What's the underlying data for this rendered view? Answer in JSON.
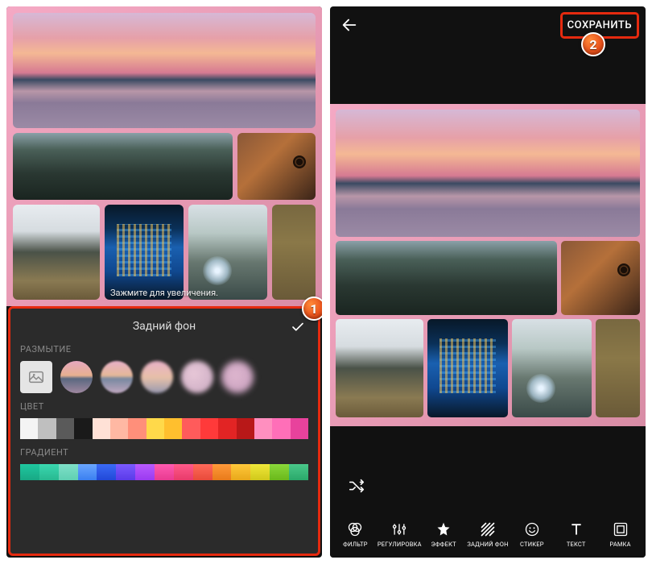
{
  "left": {
    "hint": "Зажмите для увеличения.",
    "panel_title": "Задний фон",
    "section_blur": "РАЗМЫТИЕ",
    "section_color": "ЦВЕТ",
    "section_gradient": "ГРАДИЕНТ",
    "marker": "1",
    "colors": [
      "#f4f4f4",
      "#bfbfbf",
      "#5a5a5a",
      "#1a1a1a",
      "#ffe1d6",
      "#ffb8a3",
      "#ff8f7a",
      "#ffd94a",
      "#ffbf2e",
      "#ff5b5b",
      "#ff3a3a",
      "#e22424",
      "#b81818",
      "#ff8fbf",
      "#ff6fb8",
      "#e8429c"
    ],
    "gradients": [
      [
        "#1fc8a0",
        "#18a884"
      ],
      [
        "#3ad8b0",
        "#28b890"
      ],
      [
        "#7fe0c8",
        "#5fcfb2"
      ],
      [
        "#6aa6ff",
        "#3a7ff0"
      ],
      [
        "#3a6af5",
        "#2148d8"
      ],
      [
        "#7a5aff",
        "#5a3ae8"
      ],
      [
        "#b85aff",
        "#9a3af0"
      ],
      [
        "#ff5ab0",
        "#e83a90"
      ],
      [
        "#ff5a8a",
        "#e83a6a"
      ],
      [
        "#ff6a5a",
        "#e84a3a"
      ],
      [
        "#ff9a3a",
        "#e87a1a"
      ],
      [
        "#ffc83a",
        "#e8a81a"
      ],
      [
        "#f0e83a",
        "#d0c81a"
      ],
      [
        "#8ad83a",
        "#6ab81a"
      ],
      [
        "#4ac88a",
        "#2aa86a"
      ]
    ]
  },
  "right": {
    "save_label": "СОХРАНИТЬ",
    "marker": "2",
    "tools": [
      {
        "id": "filter",
        "label": "ФИЛЬТР"
      },
      {
        "id": "adjust",
        "label": "РЕГУЛИРОВКА"
      },
      {
        "id": "effect",
        "label": "ЭФФЕКТ"
      },
      {
        "id": "background",
        "label": "ЗАДНИЙ ФОН"
      },
      {
        "id": "sticker",
        "label": "СТИКЕР"
      },
      {
        "id": "text",
        "label": "ТЕКСТ"
      },
      {
        "id": "frame",
        "label": "РАМКА"
      }
    ]
  }
}
